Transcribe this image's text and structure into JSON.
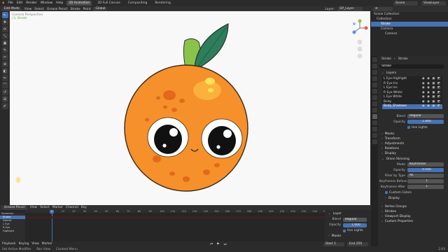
{
  "topbar": {
    "logo": "◆",
    "menus": [
      "File",
      "Edit",
      "Render",
      "Window",
      "Help"
    ],
    "tabs": [
      "2D Animation",
      "2D Full Canvas",
      "Compositing",
      "Rendering"
    ],
    "scene_label": "Scene",
    "view_layer_label": "ViewLayer"
  },
  "viewport_header": {
    "mode": "Edit Mode",
    "menus": [
      "View",
      "Select",
      "Grease Pencil",
      "Stroke",
      "Point"
    ],
    "orientation": "Global",
    "layer_label": "Layer:",
    "layer_value": "GP_Layer"
  },
  "viewport": {
    "info_line1": "Camera Perspective",
    "info_line2": "(1) Stroke"
  },
  "tools": [
    "↖",
    "✥",
    "⟳",
    "⤡",
    "▣",
    "✎",
    "✂",
    "⊕",
    "◧",
    "✏",
    "⌒",
    "↺",
    "⊞",
    "✐"
  ],
  "timeline": {
    "header_menus": [
      "Grease Pencil",
      "View",
      "Select",
      "Marker",
      "Channel",
      "Key"
    ],
    "ticks": [
      "0",
      "10",
      "20",
      "30",
      "40",
      "50",
      "60",
      "70",
      "80",
      "90",
      "100",
      "110",
      "120",
      "130",
      "140",
      "150",
      "160",
      "170",
      "180",
      "190",
      "200",
      "210",
      "220",
      "230",
      "240",
      "250"
    ],
    "current_frame": "1",
    "channels": [
      "Summary",
      "Stroke",
      "Details",
      "L Eye",
      "R Eye",
      "Highlight"
    ],
    "mini_panel": {
      "title": "Layer",
      "blend_label": "Blend",
      "blend_value": "Regular",
      "opacity_label": "Opacity",
      "opacity_value": "1.000",
      "use_lights": "Use Lights",
      "masks": "Masks"
    },
    "playback": "Playback",
    "keying": "Keying",
    "view": "View",
    "marker": "Marker",
    "start_label": "Start",
    "start_value": "1",
    "end_label": "End",
    "end_value": "250"
  },
  "status_bar": {
    "items": [
      "Set Active Modifier",
      "Pan View",
      "Context Menu"
    ],
    "version": "2.93"
  },
  "outliner": {
    "title": "Scene Collection",
    "rows": [
      "Collection",
      "Stroke",
      "Camera",
      "Camera"
    ]
  },
  "properties": {
    "breadcrumb_obj": "Stroke",
    "breadcrumb_data": "Stroke",
    "datablock": "Stroke",
    "layers_title": "Layers",
    "layers": [
      "L Eye Highlight",
      "R Eye Ins",
      "L Eye Ins",
      "R Eye White",
      "L Eye White",
      "Body",
      "Body_Shadows"
    ],
    "blend_label": "Blend",
    "blend_value": "Regular",
    "opacity_label": "Opacity",
    "opacity_value": "1.000",
    "use_lights": "Use Lights",
    "sections_closed": [
      "Masks",
      "Transform",
      "Adjustments",
      "Relations",
      "Display"
    ],
    "onion_title": "Onion Skinning",
    "mode_label": "Mode",
    "mode_value": "Keyframes",
    "onion_opacity_label": "Opacity",
    "onion_opacity_value": "0.500",
    "filter_label": "Filter by Type",
    "filter_value": "All",
    "kf_before_label": "Keyframes Before",
    "kf_before_value": "1",
    "kf_after_label": "Keyframes After",
    "kf_after_value": "1",
    "custom_colors": "Custom Colors",
    "display": "Display",
    "bottom_sections": [
      "Vertex Groups",
      "Strokes",
      "Viewport Display",
      "Custom Properties"
    ]
  }
}
